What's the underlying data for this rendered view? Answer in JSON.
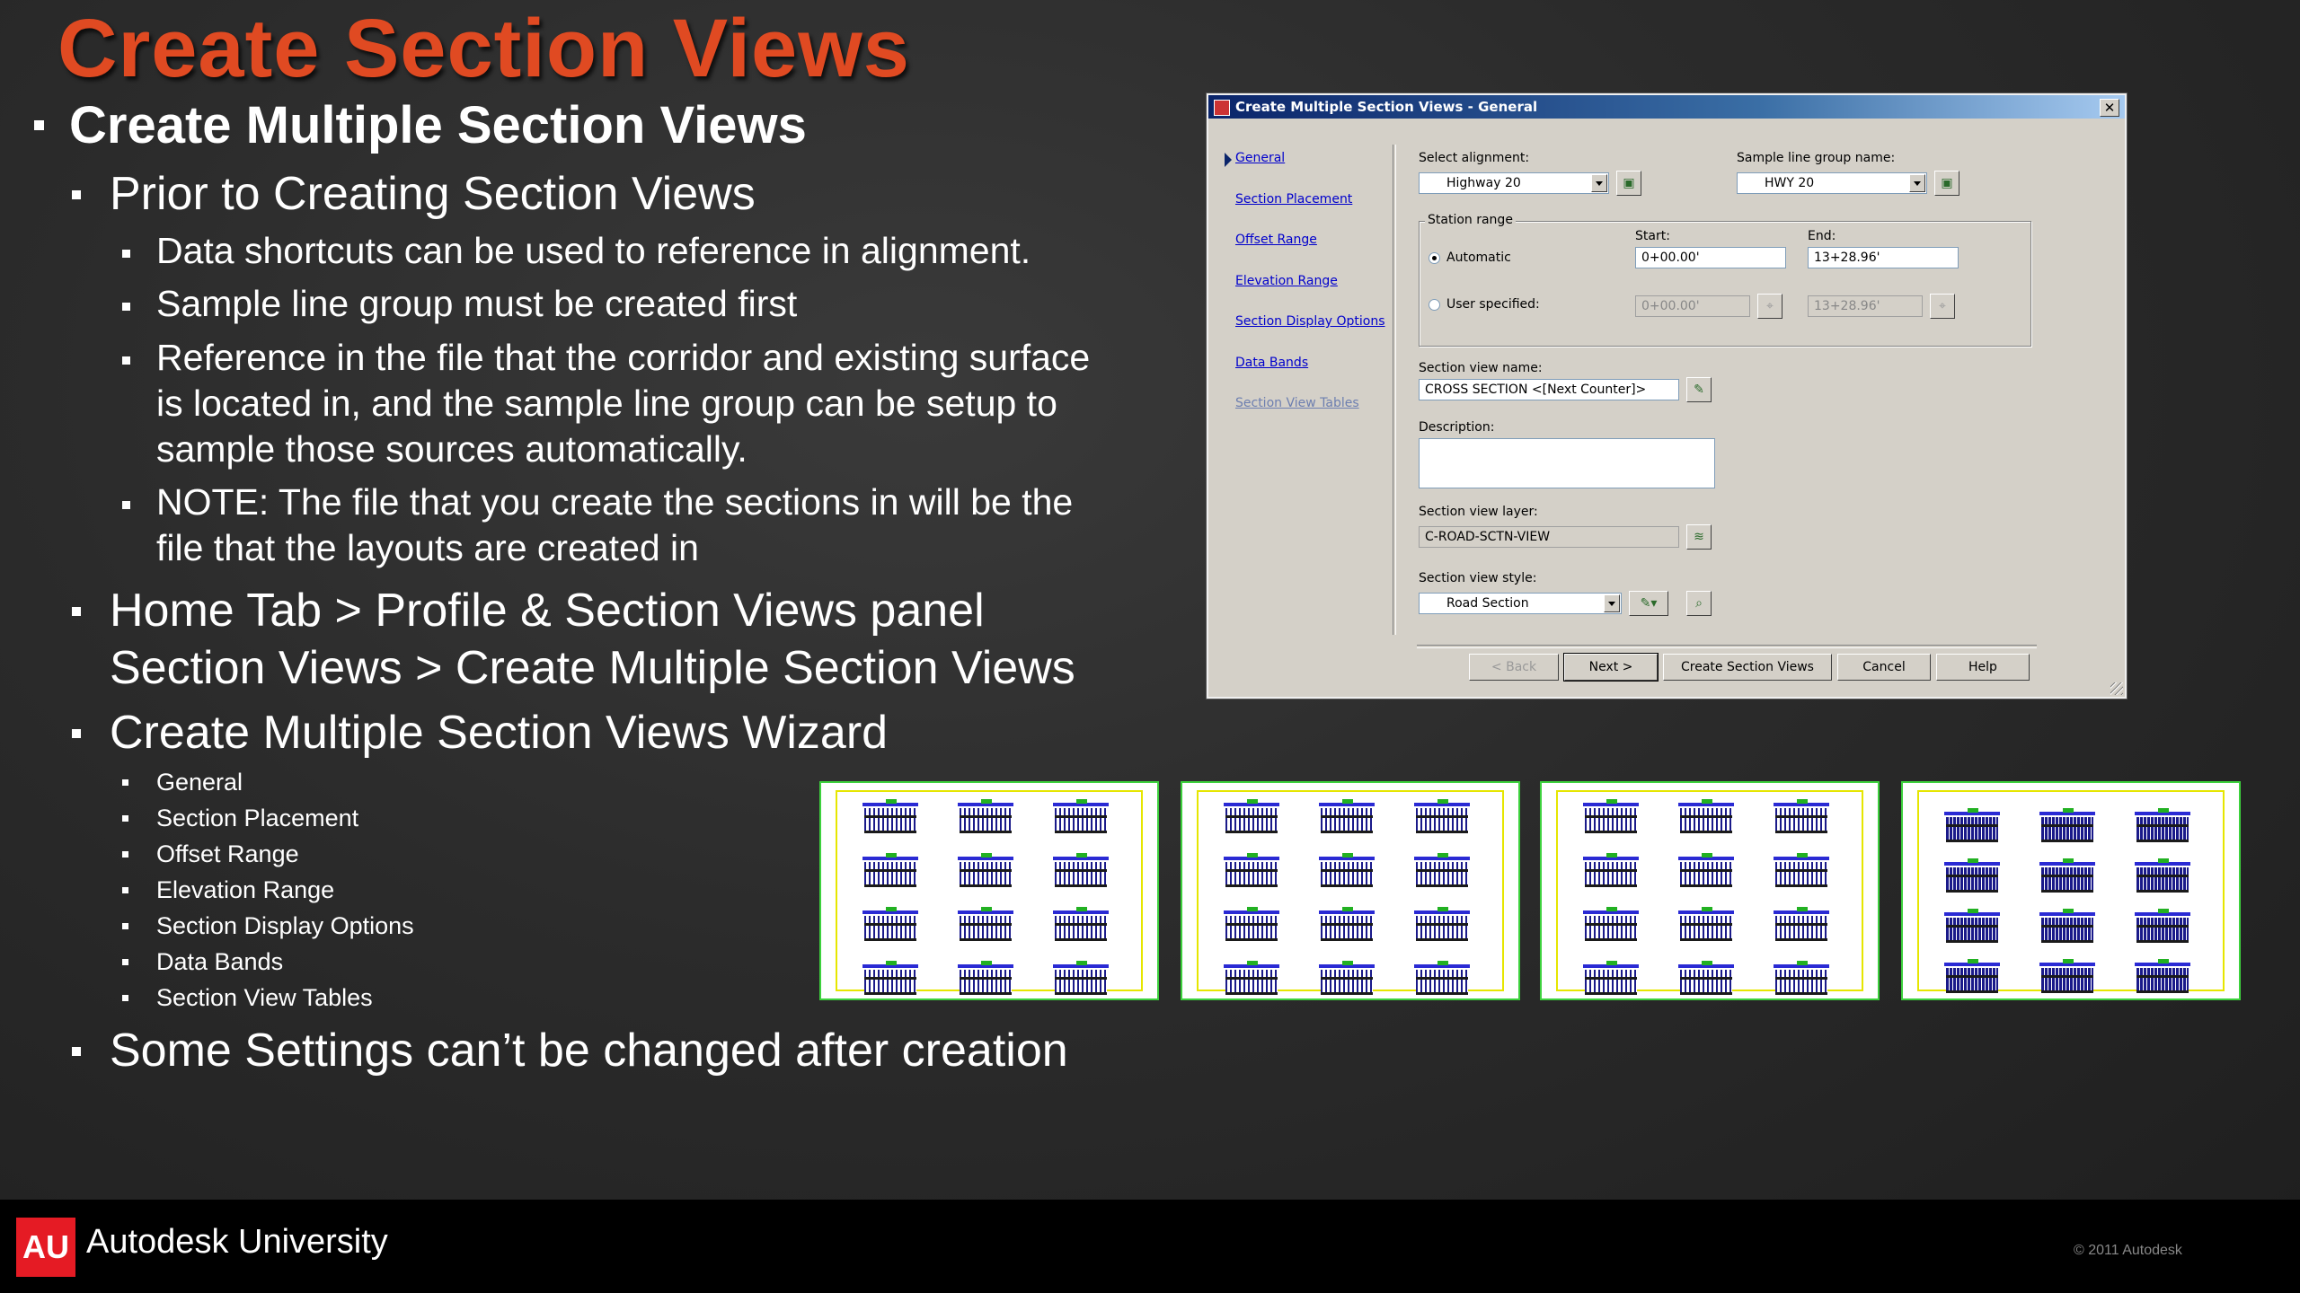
{
  "slide": {
    "title": "Create Section Views",
    "bullets": {
      "b1": "Create Multiple Section Views",
      "b2": "Prior to Creating Section Views",
      "b2_1": "Data shortcuts can be used to reference in alignment.",
      "b2_2": "Sample line group must be created first",
      "b2_3_l1": "Reference in the file that the corridor and existing surface",
      "b2_3_l2": "is located in, and the sample line group can be setup to",
      "b2_3_l3": "sample those sources automatically.",
      "b2_4_l1": "NOTE:  The file that you create the sections in will be the",
      "b2_4_l2": "file that the layouts are created in",
      "b3_l1": "Home Tab > Profile & Section Views panel",
      "b3_l2": "Section Views > Create Multiple Section Views",
      "b4": "Create Multiple Section Views Wizard",
      "wizard_pages": [
        "General",
        "Section Placement",
        "Offset Range",
        "Elevation Range",
        "Section Display Options",
        "Data Bands",
        "Section View Tables"
      ],
      "b5": "Some Settings can’t be changed after creation"
    }
  },
  "dialog": {
    "title": "Create Multiple Section Views - General",
    "close": "✕",
    "nav": [
      "General",
      "Section Placement",
      "Offset Range",
      "Elevation Range",
      "Section Display Options",
      "Data Bands",
      "Section View Tables"
    ],
    "select_alignment_label": "Select alignment:",
    "alignment_value": "Highway 20",
    "sample_line_group_label": "Sample line group name:",
    "sample_line_group_value": "HWY 20",
    "station_range_label": "Station range",
    "start_label": "Start:",
    "end_label": "End:",
    "automatic_label": "Automatic",
    "user_specified_label": "User specified:",
    "auto_start": "0+00.00'",
    "auto_end": "13+28.96'",
    "user_start": "0+00.00'",
    "user_end": "13+28.96'",
    "section_view_name_label": "Section view name:",
    "section_view_name_value": "CROSS SECTION <[Next Counter]>",
    "description_label": "Description:",
    "description_value": "",
    "section_view_layer_label": "Section view layer:",
    "section_view_layer_value": "C-ROAD-SCTN-VIEW",
    "section_view_style_label": "Section view style:",
    "section_view_style_value": "Road Section",
    "buttons": {
      "back": "< Back",
      "next": "Next >",
      "create": "Create Section Views",
      "cancel": "Cancel",
      "help": "Help"
    }
  },
  "footer": {
    "logo": "AU",
    "brand": "Autodesk University",
    "copyright": "© 2011 Autodesk"
  }
}
